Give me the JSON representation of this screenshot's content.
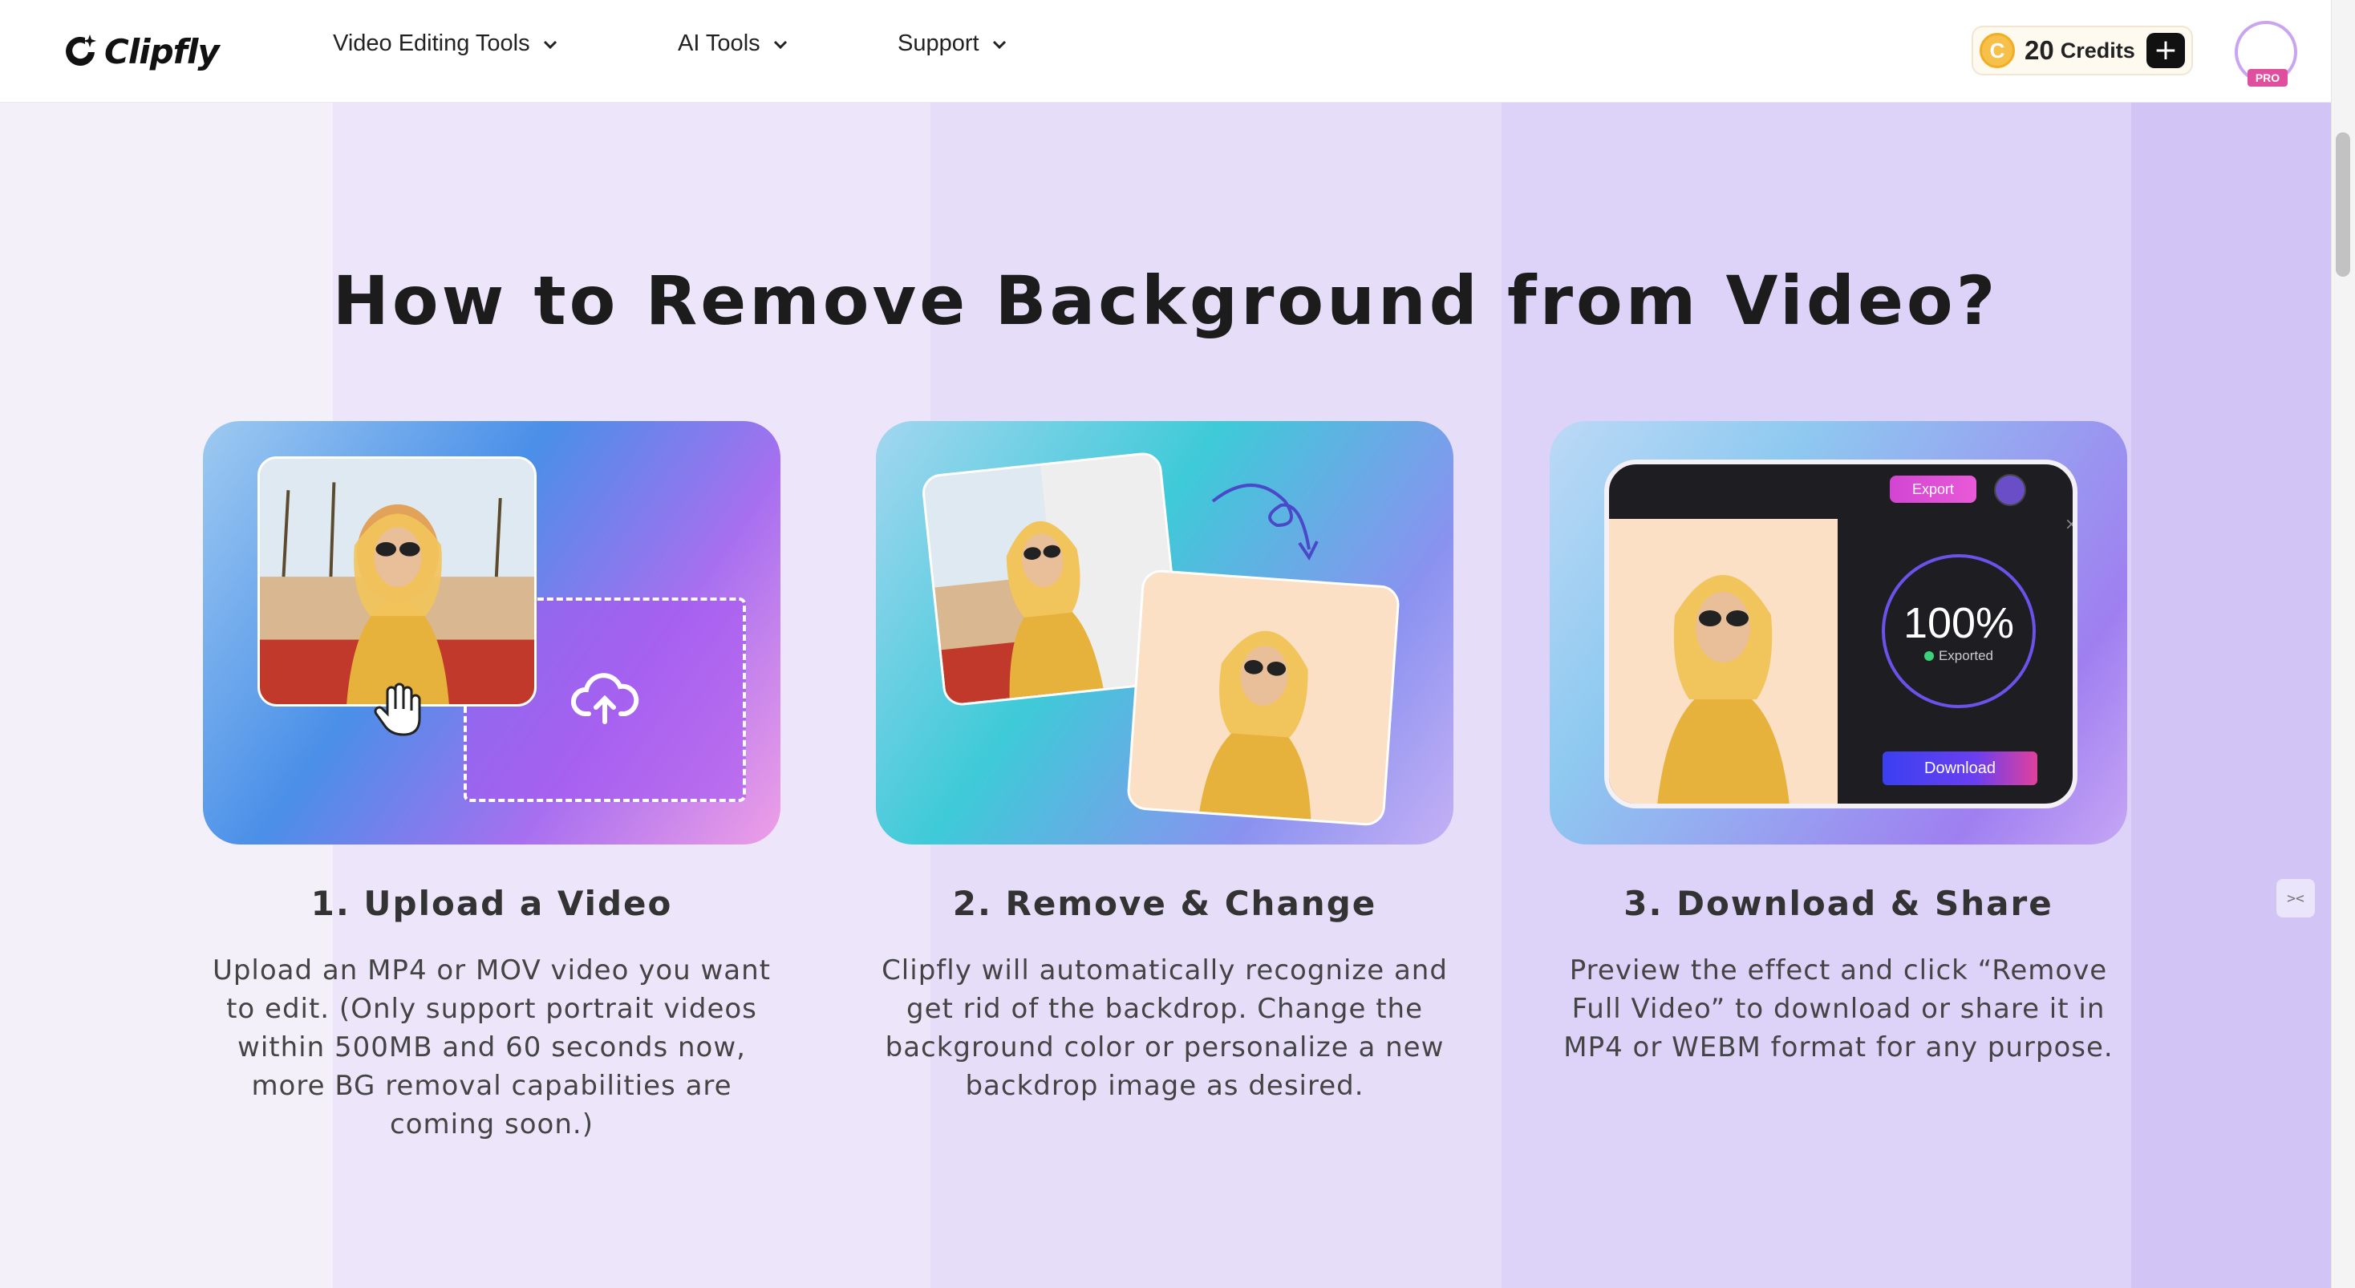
{
  "header": {
    "logo_text": "Clipfly",
    "nav": [
      {
        "label": "Video Editing Tools"
      },
      {
        "label": "AI Tools"
      },
      {
        "label": "Support"
      }
    ],
    "credits": {
      "coin": "C",
      "count": "20",
      "label": "Credits",
      "add": "+"
    },
    "avatar_badge": "PRO"
  },
  "main": {
    "title": "How to Remove Background from Video?",
    "steps": [
      {
        "title": "1. Upload a Video",
        "description": "Upload an MP4 or MOV video you want to edit. (Only support portrait videos within 500MB and 60 seconds now, more BG removal capabilities are coming soon.)"
      },
      {
        "title": "2. Remove & Change",
        "description": "Clipfly will automatically recognize and get rid of the backdrop. Change the background color or personalize a new backdrop image as desired."
      },
      {
        "title": "3. Download & Share",
        "description": "Preview the effect and click “Remove Full Video” to download or share it in MP4 or WEBM format for any purpose."
      }
    ],
    "export_card": {
      "export_label": "Export",
      "progress": "100%",
      "progress_value": 1.0,
      "status": "Exported",
      "download_label": "Download",
      "close": "×"
    }
  },
  "side_widget": "><",
  "colors": {
    "accent_purple": "#a756f0",
    "export_pink": "#e85ad8",
    "status_green": "#3bd37a",
    "coin_gold": "#f6c04a"
  },
  "icons": [
    "clipfly-logo-icon",
    "chevron-down-icon",
    "upload-cloud-icon",
    "hand-cursor-icon",
    "curved-arrow-icon"
  ]
}
